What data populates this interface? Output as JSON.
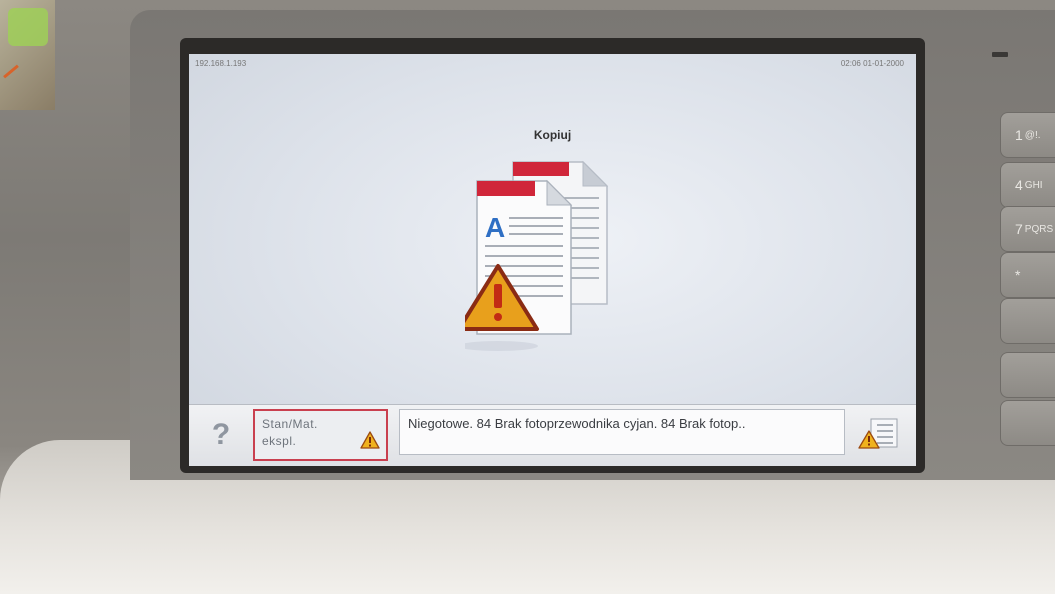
{
  "screen": {
    "ip_address": "192.168.1.193",
    "datetime": "02:06 01-01-2000",
    "app_title": "Kopiuj"
  },
  "bottom_bar": {
    "help_label": "?",
    "status_label": "Stan/Mat.\nekspl.",
    "message": "Niegotowe. 84 Brak fotoprzewodnika cyjan. 84 Brak fotop.."
  },
  "keypad": {
    "keys": [
      {
        "digit": "1",
        "letters": "@!."
      },
      {
        "digit": "4",
        "letters": "GHI"
      },
      {
        "digit": "7",
        "letters": "PQRS"
      },
      {
        "digit": "*",
        "letters": ""
      }
    ]
  },
  "colors": {
    "warning": "#e8a01c",
    "status_border": "#c9404f",
    "document_header": "#d0263a"
  },
  "icons": {
    "app": "copy-document-warning-icon",
    "status": "warning-icon",
    "list": "menu-list-warning-icon"
  }
}
